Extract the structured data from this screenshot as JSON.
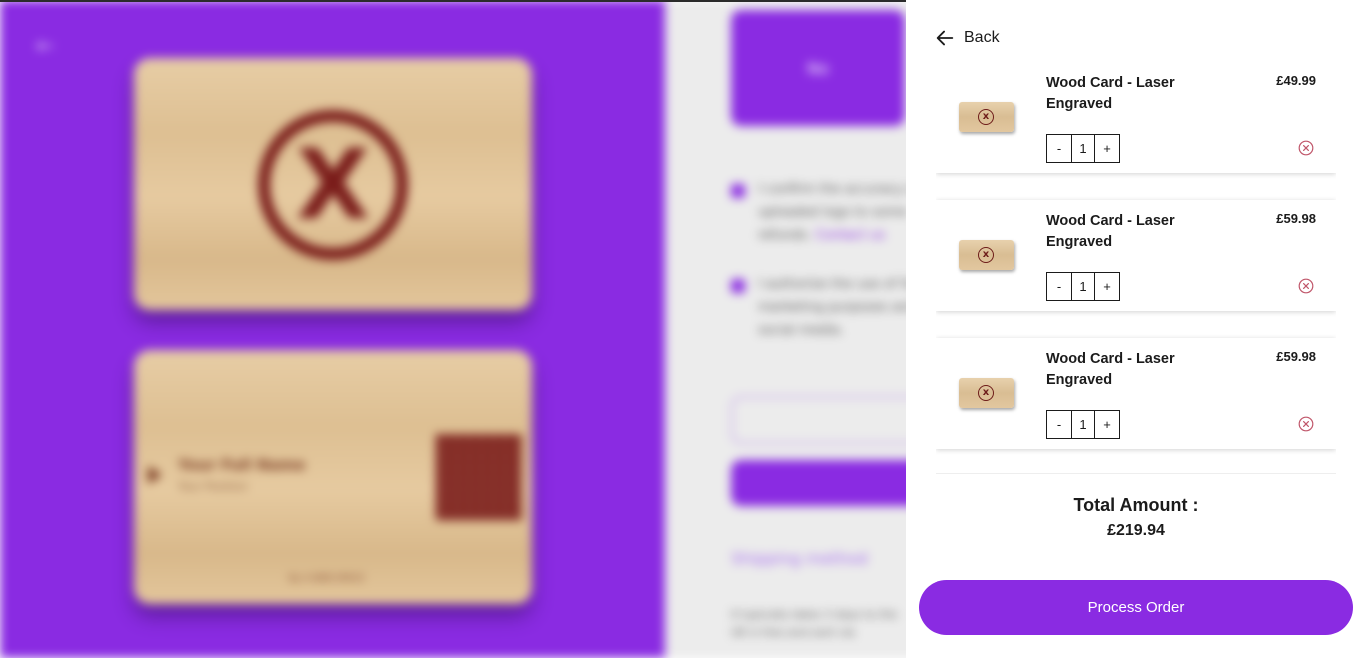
{
  "background": {
    "confirm_button_label": "No",
    "checkbox_text_1": "I confirm the accuracy of uploaded logo to some refunds.",
    "checkbox_link_1": "Contact us",
    "checkbox_text_2": "I authorize the use of for marketing purposes and social media.",
    "shipping_heading": "Shipping method",
    "shipping_text": "It typically takes 3 days to the UK is free and sent via",
    "card_name": "Your Full Name",
    "card_position": "Your Position",
    "card_footer": "By 4 WEB SPECE",
    "colors": {
      "brand_purple": "#8a2be2",
      "wood": "#e3c69b",
      "engraving": "#7a1c1a"
    }
  },
  "drawer": {
    "back_label": "Back",
    "back_icon": "arrow-left-icon",
    "items": [
      {
        "title": "Wood Card - Laser Engraved",
        "price": "£49.99",
        "quantity": "1",
        "minus": "-",
        "plus": "+",
        "thumb_icon": "wood-card-thumbnail",
        "remove_icon": "remove-circle-x-icon"
      },
      {
        "title": "Wood Card - Laser Engraved",
        "price": "£59.98",
        "quantity": "1",
        "minus": "-",
        "plus": "+",
        "thumb_icon": "wood-card-thumbnail",
        "remove_icon": "remove-circle-x-icon"
      },
      {
        "title": "Wood Card - Laser Engraved",
        "price": "£59.98",
        "quantity": "1",
        "minus": "-",
        "plus": "+",
        "thumb_icon": "wood-card-thumbnail",
        "remove_icon": "remove-circle-x-icon"
      }
    ],
    "total_label": "Total Amount :",
    "total_value": "£219.94",
    "process_button_label": "Process Order",
    "colors": {
      "accent": "#8a2be2",
      "remove_icon": "#c0566a",
      "text": "#1b1b1b"
    }
  }
}
